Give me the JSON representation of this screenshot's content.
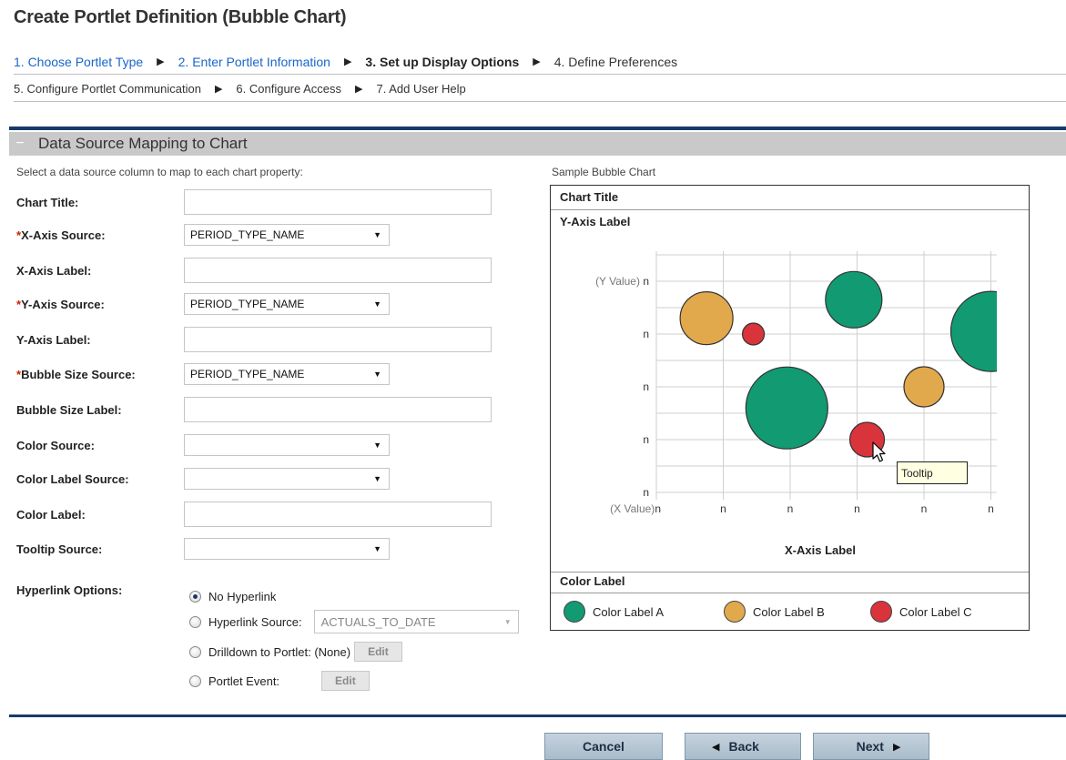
{
  "page": {
    "title": "Create Portlet Definition (Bubble Chart)"
  },
  "steps": {
    "row1": [
      {
        "label": "1. Choose Portlet Type",
        "state": "link"
      },
      {
        "label": "2. Enter Portlet Information",
        "state": "link"
      },
      {
        "label": "3. Set up Display Options",
        "state": "current"
      },
      {
        "label": "4. Define Preferences",
        "state": "plain"
      }
    ],
    "row2": [
      {
        "label": "5. Configure Portlet Communication",
        "state": "plain"
      },
      {
        "label": "6. Configure Access",
        "state": "plain"
      },
      {
        "label": "7. Add User Help",
        "state": "plain"
      }
    ]
  },
  "section": {
    "collapse_glyph": "−",
    "title": "Data Source Mapping to Chart",
    "intro": "Select a data source column to map to each chart property:",
    "sample_caption": "Sample Bubble Chart"
  },
  "form": {
    "fields": [
      {
        "label": "Chart Title:",
        "required": false,
        "type": "text",
        "value": ""
      },
      {
        "label": "X-Axis Source:",
        "required": true,
        "type": "select",
        "value": "PERIOD_TYPE_NAME"
      },
      {
        "label": "X-Axis Label:",
        "required": false,
        "type": "text",
        "value": ""
      },
      {
        "label": "Y-Axis Source:",
        "required": true,
        "type": "select",
        "value": "PERIOD_TYPE_NAME"
      },
      {
        "label": "Y-Axis Label:",
        "required": false,
        "type": "text",
        "value": ""
      },
      {
        "label": "Bubble Size Source:",
        "required": true,
        "type": "select",
        "value": "PERIOD_TYPE_NAME"
      },
      {
        "label": "Bubble Size Label:",
        "required": false,
        "type": "text",
        "value": ""
      },
      {
        "label": "Color Source:",
        "required": false,
        "type": "select",
        "value": ""
      },
      {
        "label": "Color Label Source:",
        "required": false,
        "type": "select",
        "value": ""
      },
      {
        "label": "Color Label:",
        "required": false,
        "type": "text",
        "value": ""
      },
      {
        "label": "Tooltip Source:",
        "required": false,
        "type": "select",
        "value": ""
      }
    ],
    "required_marker": "*"
  },
  "hyperlink": {
    "label": "Hyperlink Options:",
    "no_hyperlink": "No Hyperlink",
    "source_label": "Hyperlink Source:",
    "source_value": "ACTUALS_TO_DATE",
    "drilldown_label": "Drilldown to Portlet: (None)",
    "event_label": "Portlet Event:",
    "edit_label": "Edit",
    "selected": "no_hyperlink"
  },
  "chart_data": {
    "type": "bubble",
    "title": "Chart Title",
    "ylabel": "Y-Axis Label",
    "xlabel": "X-Axis Label",
    "x_ticks": [
      "(X Value) n",
      "n",
      "n",
      "n",
      "n",
      "n"
    ],
    "y_ticks": [
      "(Y Value) n",
      "n",
      "n",
      "n",
      "n"
    ],
    "legend_title": "Color Label",
    "categories": [
      {
        "name": "Color Label A",
        "color": "#129a72"
      },
      {
        "name": "Color Label B",
        "color": "#e2a94c"
      },
      {
        "name": "Color Label C",
        "color": "#d9333b"
      }
    ],
    "bubbles": [
      {
        "x": 0.75,
        "y": 3.3,
        "size": 29,
        "category": 1
      },
      {
        "x": 1.45,
        "y": 3.0,
        "size": 12,
        "category": 2
      },
      {
        "x": 2.95,
        "y": 3.65,
        "size": 31,
        "category": 0
      },
      {
        "x": 5.0,
        "y": 3.05,
        "size": 44,
        "category": 0
      },
      {
        "x": 1.95,
        "y": 1.6,
        "size": 45,
        "category": 0
      },
      {
        "x": 4.0,
        "y": 2.0,
        "size": 22,
        "category": 1
      },
      {
        "x": 3.15,
        "y": 1.0,
        "size": 19,
        "category": 2
      }
    ],
    "tooltip": "Tooltip"
  },
  "footer": {
    "cancel": "Cancel",
    "back": "Back",
    "next": "Next"
  }
}
